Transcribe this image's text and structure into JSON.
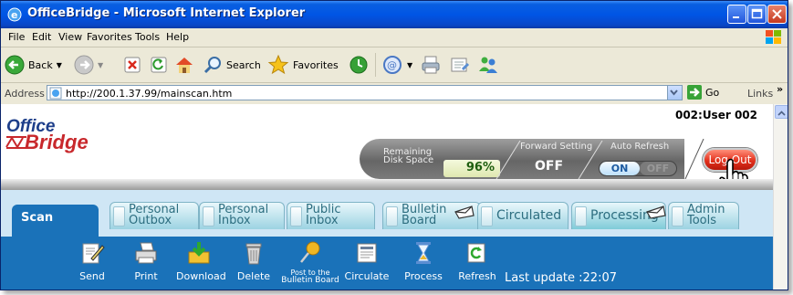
{
  "window": {
    "title": "OfficeBridge - Microsoft Internet Explorer"
  },
  "menu": [
    "File",
    "Edit",
    "View",
    "Favorites",
    "Tools",
    "Help"
  ],
  "toolbar": {
    "back_label": "Back",
    "search_label": "Search",
    "favorites_label": "Favorites"
  },
  "address": {
    "label": "Address",
    "url": "http://200.1.37.99/mainscan.htm",
    "go_label": "Go",
    "links_label": "Links"
  },
  "app": {
    "logo_top": "Office",
    "logo_bottom": "Bridge",
    "user_id": "002:User 002",
    "remaining_label_1": "Remaining",
    "remaining_label_2": "Disk Space",
    "disk_percent": "96%",
    "forward_label": "Forward Setting",
    "forward_value": "OFF",
    "auto_refresh_label": "Auto Refresh",
    "auto_refresh_on": "ON",
    "auto_refresh_off": "OFF",
    "logout_label": "Log Out"
  },
  "tabs": [
    {
      "line1": "Scan",
      "line2": ""
    },
    {
      "line1": "Personal",
      "line2": "Outbox"
    },
    {
      "line1": "Personal",
      "line2": "Inbox"
    },
    {
      "line1": "Public",
      "line2": "Inbox"
    },
    {
      "line1": "Bulletin",
      "line2": "Board"
    },
    {
      "line1": "Circulated",
      "line2": ""
    },
    {
      "line1": "Processing",
      "line2": ""
    },
    {
      "line1": "Admin",
      "line2": "Tools"
    }
  ],
  "actions": [
    {
      "label": "Send",
      "icon": "send-icon"
    },
    {
      "label": "Print",
      "icon": "printer-icon"
    },
    {
      "label": "Download",
      "icon": "download-icon"
    },
    {
      "label": "Delete",
      "icon": "trash-icon"
    },
    {
      "label_line1": "Post to the",
      "label_line2": "Bulletin Board",
      "icon": "pin-icon"
    },
    {
      "label": "Circulate",
      "icon": "document-icon"
    },
    {
      "label": "Process",
      "icon": "hourglass-icon"
    },
    {
      "label": "Refresh",
      "icon": "refresh-icon"
    }
  ],
  "last_update": "Last update :22:07",
  "colors": {
    "title_blue": "#0055e5",
    "app_blue": "#1a72b9",
    "tab_light": "#cfe6f5",
    "logout_red": "#e2301c",
    "disk_green": "#1e5e10"
  }
}
